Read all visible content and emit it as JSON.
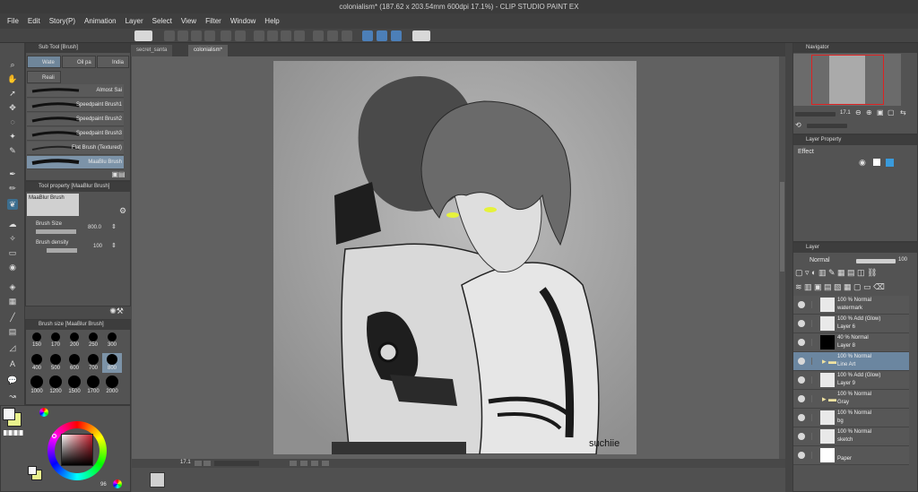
{
  "window": {
    "title": "colonialism* (187.62 x 203.54mm 600dpi 17.1%)  - CLIP STUDIO PAINT EX"
  },
  "menu": [
    "File",
    "Edit",
    "Story(P)",
    "Animation",
    "Layer",
    "Select",
    "View",
    "Filter",
    "Window",
    "Help"
  ],
  "subtool": {
    "header": "Sub Tool [Brush]",
    "tabs": [
      "Wate",
      "Oil pa",
      "India",
      "Reali"
    ],
    "brushes": [
      "Almost Sai",
      "Speedpaint Brush1",
      "Speedpaint Brush2",
      "Speedpaint Brush3",
      "Flat Brush (Textured)",
      "MaaBlu Brush"
    ],
    "selected_brush": "MaaBlu Brush"
  },
  "tool_property": {
    "header": "Tool property [MaaBlur Brush]",
    "preview_name": "MaaBlur Brush",
    "brush_size_label": "Brush Size",
    "brush_size_value": "800.0",
    "brush_size_level": 1.0,
    "brush_density_label": "Brush density",
    "brush_density_value": "100",
    "brush_density_level": 1.0
  },
  "brush_size_panel": {
    "header": "Brush size [MaaBlur Brush]",
    "sizes": [
      "150",
      "170",
      "200",
      "250",
      "300",
      "400",
      "500",
      "600",
      "700",
      "800",
      "1000",
      "1200",
      "1500",
      "1700",
      "2000"
    ],
    "selected": "800"
  },
  "color": {
    "main": "#f5f5f5",
    "sub": "#e9f28c",
    "hue_square": "#c81f2e",
    "opacity_value": "96"
  },
  "documents": {
    "tabs": [
      "secret_santa",
      "colonialism*"
    ],
    "active": "colonialism*"
  },
  "canvas": {
    "signature": "suchiie",
    "zoom": "17.1"
  },
  "navigator": {
    "header": "Navigator",
    "zoom": "17.1"
  },
  "layer_property": {
    "header": "Layer Property",
    "effect_label": "Effect"
  },
  "layer_panel": {
    "header": "Layer",
    "blend_mode": "Normal",
    "opacity": "100",
    "layers": [
      {
        "mode": "100 % Normal",
        "name": "watermark",
        "thumb": "#e9e9e9",
        "folder": false
      },
      {
        "mode": "100 % Add (Glow)",
        "name": "Layer 6",
        "thumb": "#e9e9e9",
        "folder": false
      },
      {
        "mode": "40 % Normal",
        "name": "Layer 8",
        "thumb": "#000000",
        "folder": false
      },
      {
        "mode": "100 % Normal",
        "name": "Line Art",
        "thumb": "",
        "folder": true
      },
      {
        "mode": "100 % Add (Glow)",
        "name": "Layer 9",
        "thumb": "#e9e9e9",
        "folder": false
      },
      {
        "mode": "100 % Normal",
        "name": "Gray",
        "thumb": "",
        "folder": true
      },
      {
        "mode": "100 % Normal",
        "name": "bg",
        "thumb": "#e9e9e9",
        "folder": false
      },
      {
        "mode": "100 % Normal",
        "name": "sketch",
        "thumb": "#e9e9e9",
        "folder": false
      },
      {
        "mode": "",
        "name": "Paper",
        "thumb": "#ffffff",
        "folder": false
      }
    ],
    "selected": "Line Art"
  }
}
